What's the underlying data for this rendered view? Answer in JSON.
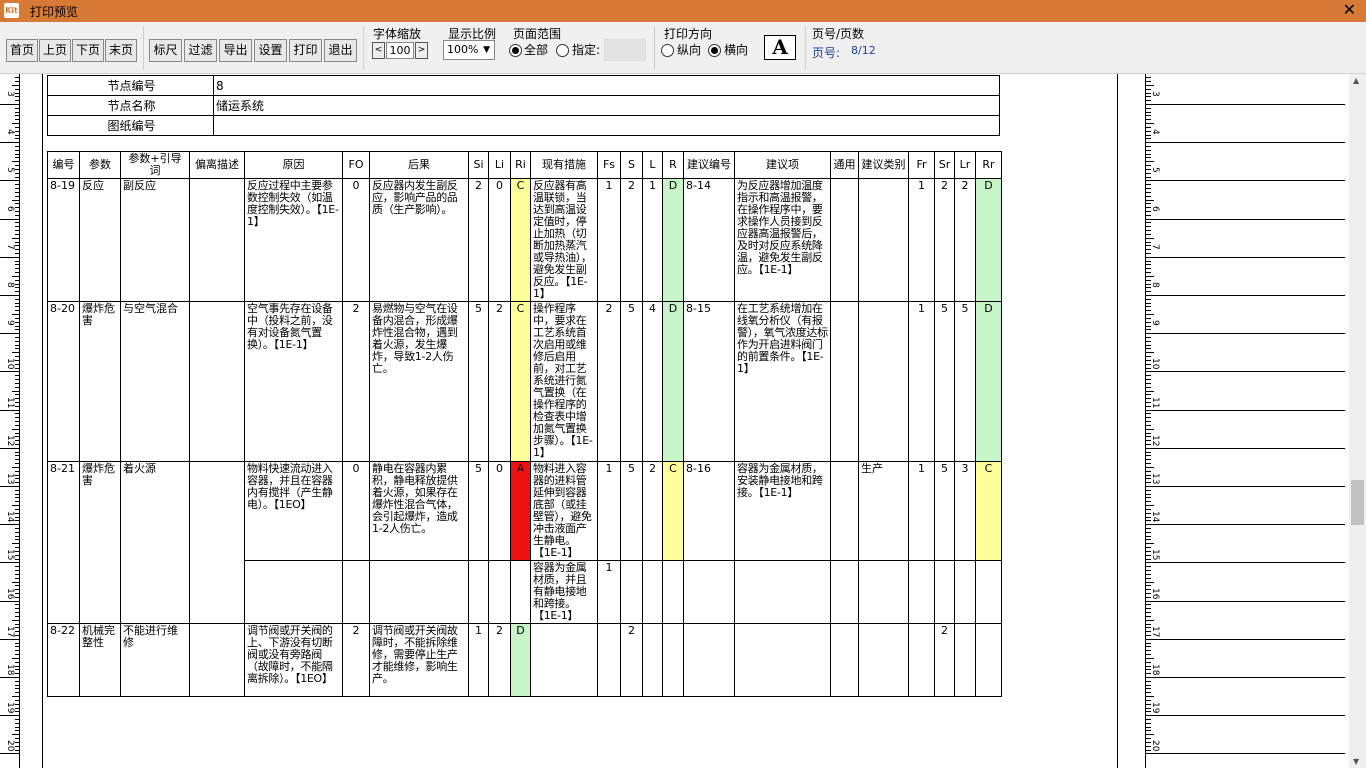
{
  "window": {
    "title": "打印预览",
    "app_icon_text": "Kit"
  },
  "toolbar": {
    "nav_buttons": [
      "首页",
      "上页",
      "下页",
      "末页"
    ],
    "tool_buttons": [
      "标尺",
      "过滤",
      "导出",
      "设置",
      "打印",
      "退出"
    ],
    "font_zoom": {
      "label": "字体缩放",
      "dec": "<",
      "inc": ">",
      "value": "100"
    },
    "display_ratio": {
      "label": "显示比例",
      "value": "100%"
    },
    "page_range": {
      "label": "页面范围",
      "all": "全部",
      "specified": "指定:",
      "all_selected": true
    },
    "orientation": {
      "label": "打印方向",
      "portrait": "纵向",
      "landscape": "横向",
      "landscape_selected": true
    },
    "font_icon": "A",
    "page_info": {
      "label": "页号/页数",
      "page_label": "页号:",
      "page_value": "8/12"
    }
  },
  "ruler": {
    "left_numbers": [
      "3",
      "4",
      "5",
      "6",
      "7",
      "8",
      "9",
      "10",
      "11",
      "12",
      "13",
      "14",
      "15",
      "16",
      "17",
      "18",
      "19",
      "20"
    ],
    "right_numbers": [
      "3",
      "4",
      "5",
      "6",
      "7",
      "8",
      "9",
      "10",
      "11",
      "12",
      "13",
      "14",
      "15",
      "16",
      "17",
      "18",
      "19",
      "20"
    ]
  },
  "node": {
    "rows": [
      {
        "key": "节点编号",
        "value": "8"
      },
      {
        "key": "节点名称",
        "value": "储运系统"
      },
      {
        "key": "图纸编号",
        "value": ""
      }
    ]
  },
  "table": {
    "headers": [
      "编号",
      "参数",
      "参数+引导词",
      "偏离描述",
      "原因",
      "FO",
      "后果",
      "Si",
      "Li",
      "Ri",
      "现有措施",
      "Fs",
      "S",
      "L",
      "R",
      "建议编号",
      "建议项",
      "通用",
      "建议类别",
      "Fr",
      "Sr",
      "Lr",
      "Rr"
    ],
    "rows": [
      {
        "id": "8-19",
        "param": "反应",
        "guide": "副反应",
        "dev": "",
        "cause": "反应过程中主要参数控制失效（如温度控制失效）。【1E-1】",
        "fo": "0",
        "cons": "反应器内发生副反应，影响产品的品质（生产影响）。",
        "si": "2",
        "li": "0",
        "ri": "C",
        "measure": "反应器有高温联锁，当达到高温设定值时，停止加热（切断加热蒸汽或导热油），避免发生副反应。【1E-1】",
        "fs": "1",
        "s": "2",
        "l": "1",
        "r": "D",
        "sug_id": "8-14",
        "sug": "为反应器增加温度指示和高温报警，在操作程序中，要求操作人员接到反应器高温报警后，及时对反应系统降温，避免发生副反应。【1E-1】",
        "common": "",
        "cat": "",
        "fr": "1",
        "sr": "2",
        "lr": "2",
        "rr": "D"
      },
      {
        "id": "8-20",
        "param": "爆炸危害",
        "guide": "与空气混合",
        "dev": "",
        "cause": "空气事先存在设备中（投料之前，没有对设备氮气置换）。【1E-1】",
        "fo": "2",
        "cons": "易燃物与空气在设备内混合，形成爆炸性混合物，遇到着火源，发生爆炸，导致1-2人伤亡。",
        "si": "5",
        "li": "2",
        "ri": "C",
        "measure": "操作程序中，要求在工艺系统首次启用或维修后启用前，对工艺系统进行氮气置换（在操作程序的检查表中增加氮气置换步骤）。【1E-1】",
        "fs": "2",
        "s": "5",
        "l": "4",
        "r": "D",
        "sug_id": "8-15",
        "sug": "在工艺系统增加在线氧分析仪（有报警），氧气浓度达标作为开启进料阀门的前置条件。【1E-1】",
        "common": "",
        "cat": "",
        "fr": "1",
        "sr": "5",
        "lr": "5",
        "rr": "D"
      },
      {
        "id": "8-21",
        "param": "爆炸危害",
        "guide": "着火源",
        "dev": "",
        "cause": "物料快速流动进入容器，并且在容器内有搅拌（产生静电）。【1EO】",
        "fo": "0",
        "cons": "静电在容器内累积，静电释放提供着火源，如果存在爆炸性混合气体，会引起爆炸，造成1-2人伤亡。",
        "si": "5",
        "li": "0",
        "ri": "A",
        "measure": "物料进入容器的进料管延伸到容器底部（或挂壁管），避免冲击液面产生静电。【1E-1】",
        "fs": "1",
        "s": "5",
        "l": "2",
        "r": "C",
        "sug_id": "8-16",
        "sug": "容器为金属材质，安装静电接地和跨接。【1E-1】",
        "common": "",
        "cat": "生产",
        "fr": "1",
        "sr": "5",
        "lr": "3",
        "rr": "C"
      },
      {
        "measure": "容器为金属材质，并且有静电接地和跨接。【1E-1】",
        "fs": "1"
      },
      {
        "id": "8-22",
        "param": "机械完整性",
        "guide": "不能进行维修",
        "dev": "",
        "cause": "调节阀或开关阀的上、下游没有切断阀或没有旁路阀（故障时，不能隔离拆除）。【1EO】",
        "fo": "2",
        "cons": "调节阀或开关阀故障时，不能拆除维修，需要停止生产才能维修，影响生产。",
        "si": "1",
        "li": "2",
        "ri": "D",
        "measure": "",
        "fs": "",
        "s": "2",
        "l": "",
        "r": "",
        "sug_id": "",
        "sug": "",
        "common": "",
        "cat": "",
        "fr": "",
        "sr": "2",
        "lr": "",
        "rr": ""
      }
    ]
  },
  "colors": {
    "title_bar": "#d77a36",
    "risk_C": "#ffff99",
    "risk_D": "#c8f5c8",
    "risk_A": "#ee1111",
    "page_link": "#1a3fa0"
  }
}
